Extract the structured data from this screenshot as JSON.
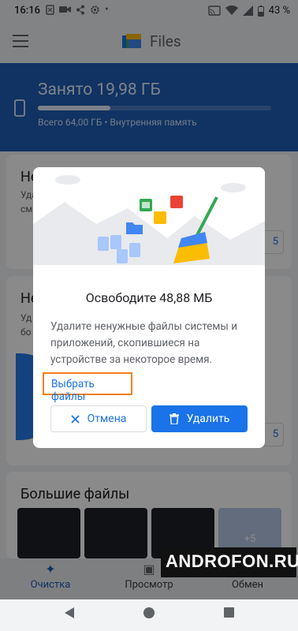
{
  "status_bar": {
    "time": "16:16",
    "battery": "43 %"
  },
  "app_bar": {
    "title": "Files"
  },
  "storage": {
    "title": "Занято 19,98 ГБ",
    "subtitle": "Всего 64,00 ГБ • Внутренняя память",
    "used_fraction": 0.31
  },
  "background_cards": {
    "card1_title_partial": "Не",
    "card1_text_partial": [
      "Уда",
      "см"
    ],
    "card1_button_partial": "5",
    "card2_title_partial": "Не",
    "card2_text_partial": [
      "Уд",
      "бо"
    ],
    "card2_button_partial": "5",
    "large_files_title": "Большие файлы",
    "more_count": "+5"
  },
  "dialog": {
    "title": "Освободите 48,88 МБ",
    "body": "Удалите ненужные файлы системы и приложений, скопившиеся на устройстве за некоторое время.",
    "select_link": "Выбрать файлы",
    "cancel_label": "Отмена",
    "delete_label": "Удалить"
  },
  "bottom_nav": {
    "items": [
      {
        "label": "Очистка",
        "icon": "sparkle-icon",
        "active": true
      },
      {
        "label": "Просмотр",
        "icon": "browse-icon",
        "active": false
      },
      {
        "label": "Обмен",
        "icon": "share-icon",
        "active": false
      }
    ]
  },
  "watermark": "ANDROFON.RU",
  "colors": {
    "accent": "#1a73e8",
    "header_blue": "#1f5fb8",
    "highlight_orange": "#f08020"
  }
}
